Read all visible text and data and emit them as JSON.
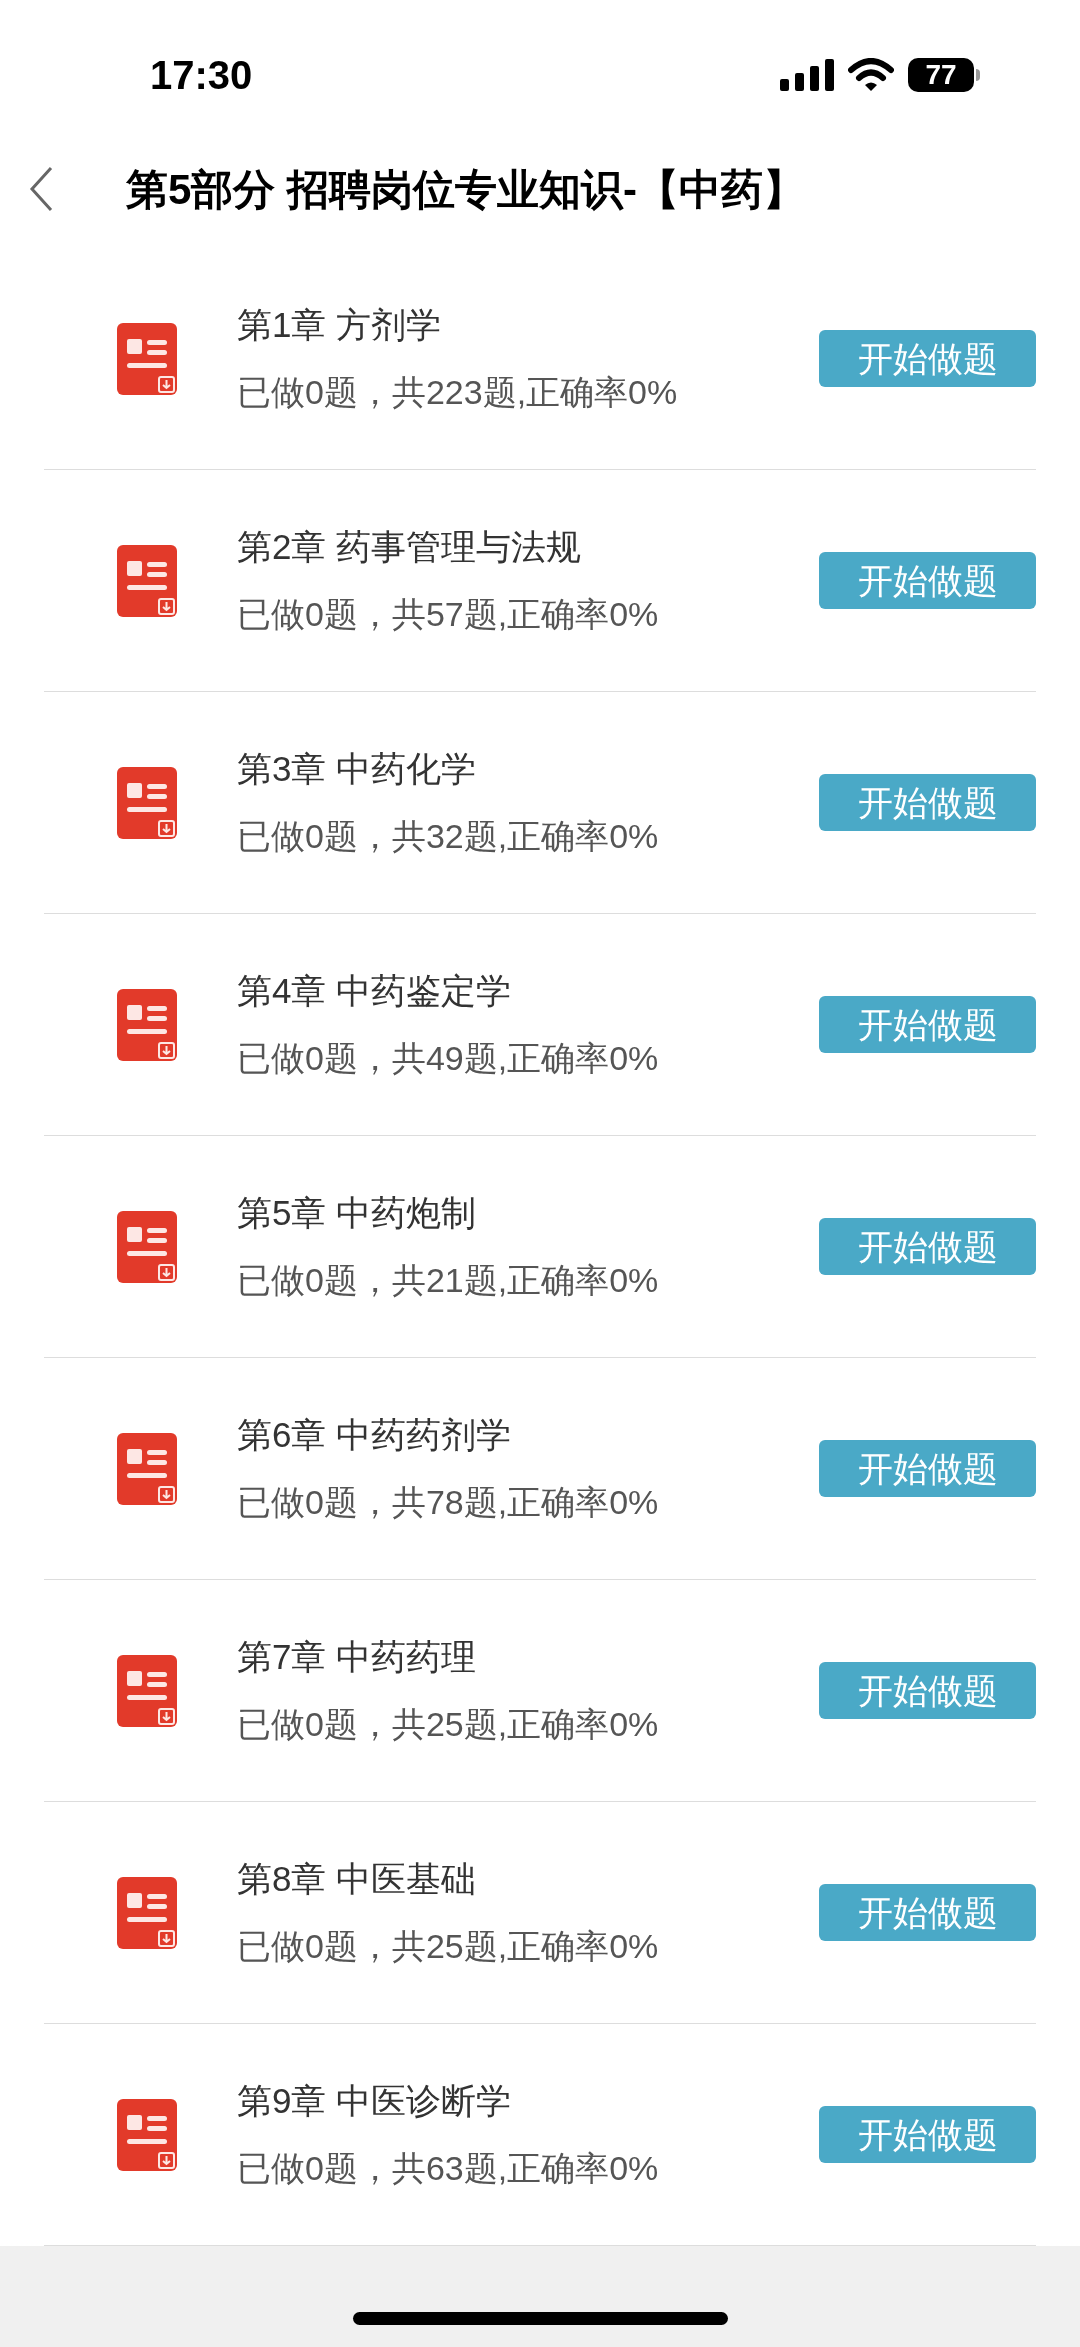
{
  "status_bar": {
    "time": "17:30",
    "battery": "77"
  },
  "nav": {
    "title": "第5部分 招聘岗位专业知识-【中药】"
  },
  "chapters": [
    {
      "title": "第1章 方剂学",
      "progress": "已做0题，共223题,正确率0%",
      "button": "开始做题"
    },
    {
      "title": "第2章 药事管理与法规",
      "progress": "已做0题，共57题,正确率0%",
      "button": "开始做题"
    },
    {
      "title": "第3章 中药化学",
      "progress": "已做0题，共32题,正确率0%",
      "button": "开始做题"
    },
    {
      "title": "第4章 中药鉴定学",
      "progress": "已做0题，共49题,正确率0%",
      "button": "开始做题"
    },
    {
      "title": "第5章 中药炮制",
      "progress": "已做0题，共21题,正确率0%",
      "button": "开始做题"
    },
    {
      "title": "第6章 中药药剂学",
      "progress": "已做0题，共78题,正确率0%",
      "button": "开始做题"
    },
    {
      "title": "第7章 中药药理",
      "progress": "已做0题，共25题,正确率0%",
      "button": "开始做题"
    },
    {
      "title": "第8章 中医基础",
      "progress": "已做0题，共25题,正确率0%",
      "button": "开始做题"
    },
    {
      "title": "第9章 中医诊断学",
      "progress": "已做0题，共63题,正确率0%",
      "button": "开始做题"
    }
  ]
}
